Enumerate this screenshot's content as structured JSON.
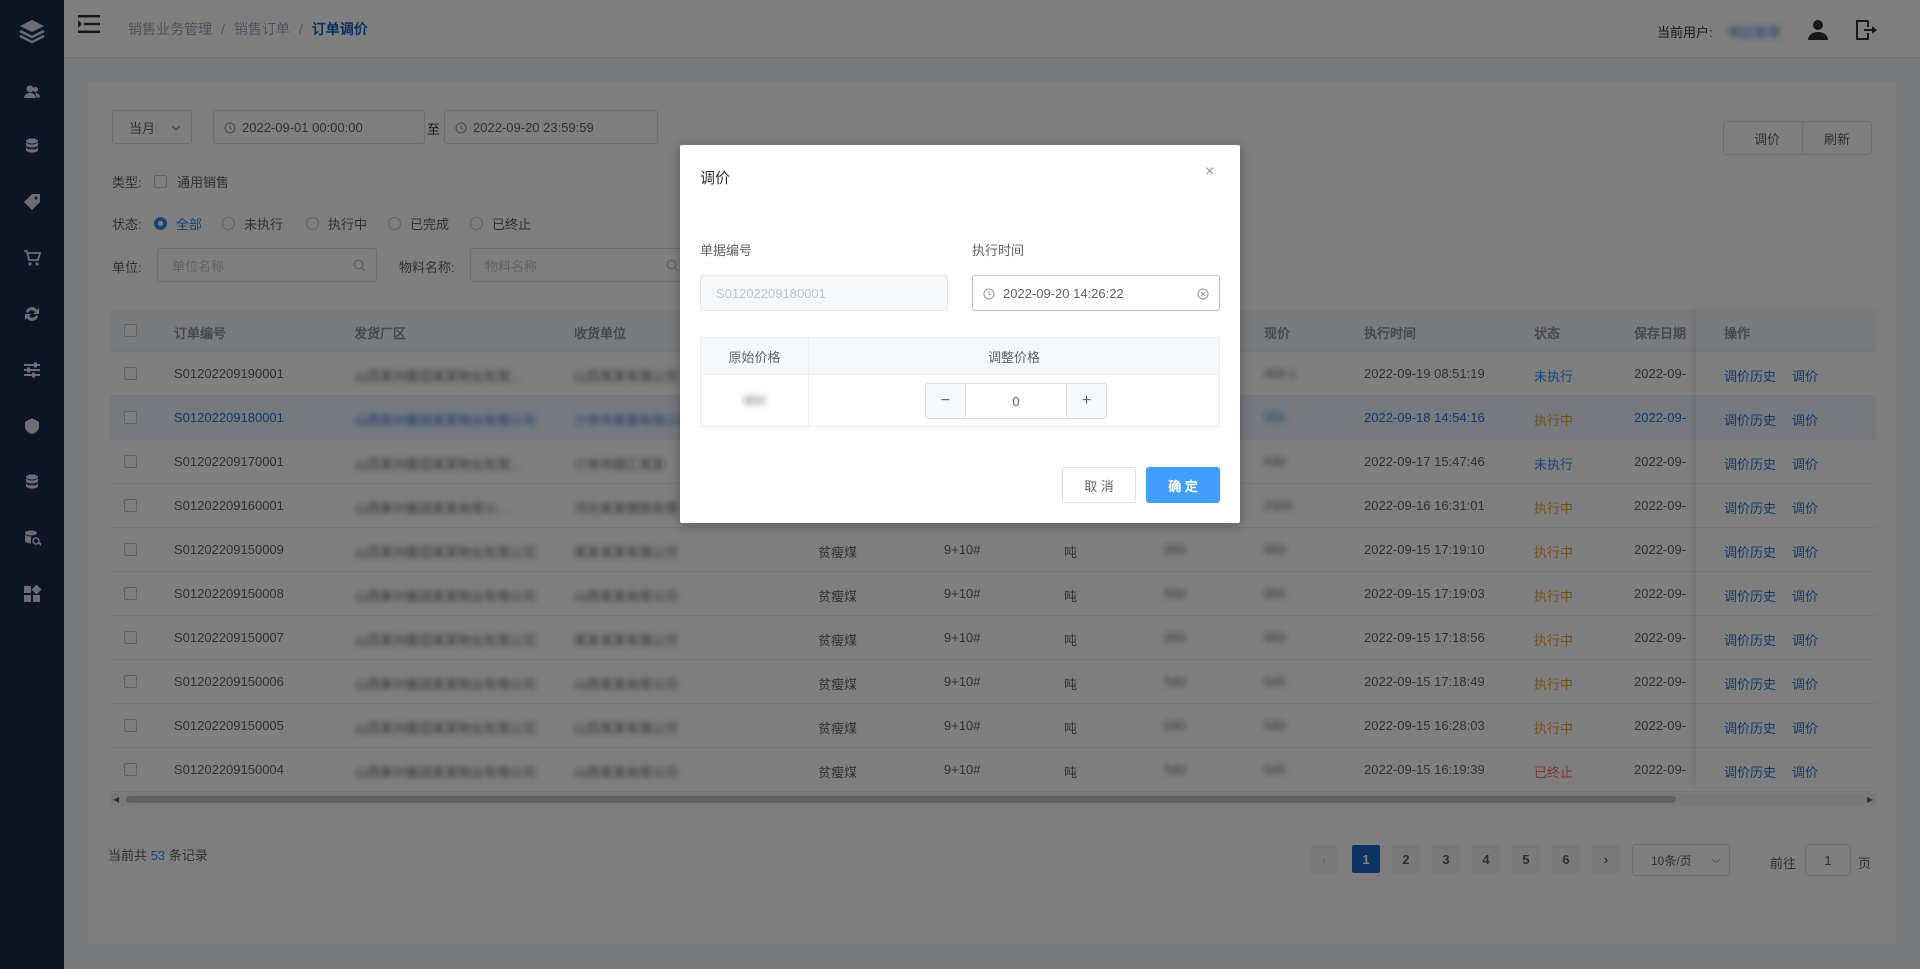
{
  "header": {
    "breadcrumb": [
      "销售业务管理",
      "销售订单",
      "订单调价"
    ],
    "separator": "/",
    "current_user_label": "当前用户:",
    "current_user": "响应管理"
  },
  "filters": {
    "period": "当月",
    "date_start": "2022-09-01 00:00:00",
    "date_to_label": "至",
    "date_end": "2022-09-20 23:59:59",
    "type_label": "类型:",
    "type_option": "通用销售",
    "status_label": "状态:",
    "status_options": [
      "全部",
      "未执行",
      "执行中",
      "已完成",
      "已终止"
    ],
    "unit_label": "单位:",
    "unit_placeholder": "单位名称",
    "material_label": "物料名称:",
    "material_placeholder": "物料名称",
    "adjust_button": "调价",
    "refresh_button": "刷新"
  },
  "table": {
    "headers": [
      "订单编号",
      "发货厂区",
      "收货单位",
      "现价",
      "执行时间",
      "状态",
      "保存日期",
      "操作"
    ],
    "history_link": "调价历史",
    "adjust_link": "调价",
    "rows": [
      {
        "id": "S01202209190001",
        "factory": "山西某州集团某某物业有限…",
        "receiver": "山西某某有限公司",
        "coal": "",
        "spec": "",
        "unit": "",
        "price1": "",
        "price": "460.1",
        "time": "2022-09-19 08:51:19",
        "status": "未执行",
        "status_class": "st-blue",
        "saved": "2022-09-"
      },
      {
        "id": "S01202209180001",
        "factory": "山西某州集团某某物业有限公司",
        "receiver": "介休市某某有限公司",
        "coal": "",
        "spec": "",
        "unit": "",
        "price1": "",
        "price": "950",
        "time": "2022-09-18 14:54:16",
        "status": "执行中",
        "status_class": "st-orange",
        "saved": "2022-09-"
      },
      {
        "id": "S01202209170001",
        "factory": "山西某州集团某某物业有限…",
        "receiver": "介休市建汇某某",
        "coal": "",
        "spec": "",
        "unit": "",
        "price1": "",
        "price": "630",
        "time": "2022-09-17 15:47:46",
        "status": "未执行",
        "status_class": "st-blue",
        "saved": "2022-09-"
      },
      {
        "id": "S01202209160001",
        "factory": "山西某州集团某某有限公…",
        "receiver": "河北某某钢铁有限",
        "coal": "",
        "spec": "",
        "unit": "",
        "price1": "",
        "price": "2300",
        "time": "2022-09-16 16:31:01",
        "status": "执行中",
        "status_class": "st-orange",
        "saved": "2022-09-"
      },
      {
        "id": "S01202209150009",
        "factory": "山西某州集团某某物业有限公司",
        "receiver": "某某某某有限公司",
        "coal": "贫瘦煤",
        "spec": "9+10#",
        "unit": "吨",
        "price1": "950",
        "price": "950",
        "time": "2022-09-15 17:19:10",
        "status": "执行中",
        "status_class": "st-orange",
        "saved": "2022-09-"
      },
      {
        "id": "S01202209150008",
        "factory": "山西某州集团某某物业有限公司",
        "receiver": "山西某某有限公司",
        "coal": "贫瘦煤",
        "spec": "9+10#",
        "unit": "吨",
        "price1": "950",
        "price": "950",
        "time": "2022-09-15 17:19:03",
        "status": "执行中",
        "status_class": "st-orange",
        "saved": "2022-09-"
      },
      {
        "id": "S01202209150007",
        "factory": "山西某州集团某某物业有限公司",
        "receiver": "某某某某有限公司",
        "coal": "贫瘦煤",
        "spec": "9+10#",
        "unit": "吨",
        "price1": "950",
        "price": "950",
        "time": "2022-09-15 17:18:56",
        "status": "执行中",
        "status_class": "st-orange",
        "saved": "2022-09-"
      },
      {
        "id": "S01202209150006",
        "factory": "山西某州集团某某物业有限公司",
        "receiver": "山西某某有限公司",
        "coal": "贫瘦煤",
        "spec": "9+10#",
        "unit": "吨",
        "price1": "540",
        "price": "540",
        "time": "2022-09-15 17:18:49",
        "status": "执行中",
        "status_class": "st-orange",
        "saved": "2022-09-"
      },
      {
        "id": "S01202209150005",
        "factory": "山西某州集团某某物业有限公司",
        "receiver": "山西某某有限公司",
        "coal": "贫瘦煤",
        "spec": "9+10#",
        "unit": "吨",
        "price1": "540",
        "price": "540",
        "time": "2022-09-15 16:28:03",
        "status": "执行中",
        "status_class": "st-orange",
        "saved": "2022-09-"
      },
      {
        "id": "S01202209150004",
        "factory": "山西某州集团某某物业有限公司",
        "receiver": "山西某某有限公司",
        "coal": "贫瘦煤",
        "spec": "9+10#",
        "unit": "吨",
        "price1": "540",
        "price": "540",
        "time": "2022-09-15 16:19:39",
        "status": "已终止",
        "status_class": "st-red",
        "saved": "2022-09-"
      }
    ]
  },
  "footer": {
    "total_prefix": "当前共",
    "total_count": "53",
    "total_suffix": "条记录",
    "pages": [
      "1",
      "2",
      "3",
      "4",
      "5",
      "6"
    ],
    "page_size": "10条/页",
    "goto_label": "前往",
    "goto_value": "1",
    "page_unit": "页"
  },
  "dialog": {
    "title": "调价",
    "close": "×",
    "doc_no_label": "单据编号",
    "doc_no_value": "S01202209180001",
    "exec_time_label": "执行时间",
    "exec_time_value": "2022-09-20 14:26:22",
    "orig_price_header": "原始价格",
    "adj_price_header": "调整价格",
    "orig_price_value": "950",
    "minus": "−",
    "plus": "+",
    "adj_value": "0",
    "cancel": "取 消",
    "confirm": "确 定"
  },
  "colors": {
    "sidebar": "#1d2a4d",
    "accent": "#2d8cf0",
    "primary_button": "#409eff"
  }
}
